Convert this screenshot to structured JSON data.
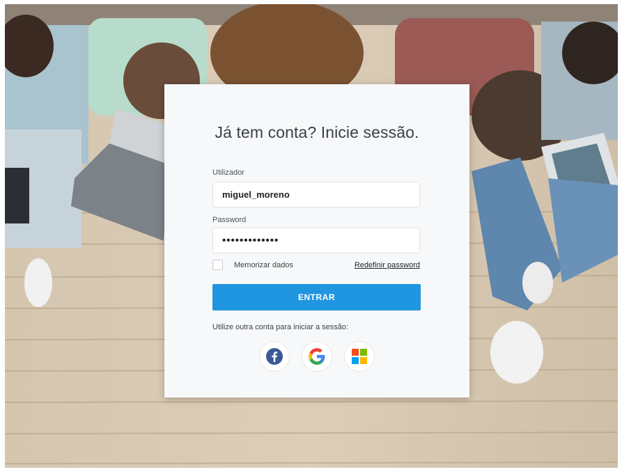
{
  "login": {
    "title": "Já tem conta? Inicie sessão.",
    "username_label": "Utilizador",
    "username_value": "miguel_moreno",
    "password_label": "Password",
    "password_value": "•••••••••••••",
    "remember_label": "Memorizar dados",
    "reset_link": "Redefinir password",
    "submit_label": "ENTRAR",
    "alt_login_label": "Utilize outra conta para iniciar a sessão:"
  },
  "social_icons": [
    "facebook-icon",
    "google-icon",
    "microsoft-icon"
  ],
  "colors": {
    "primary_button": "#2196e0",
    "facebook": "#3b5998",
    "google_blue": "#4285f4",
    "google_red": "#ea4335",
    "google_yellow": "#fbbc05",
    "google_green": "#34a853",
    "ms_red": "#f25022",
    "ms_green": "#7fba00",
    "ms_blue": "#00a4ef",
    "ms_yellow": "#ffb900"
  }
}
